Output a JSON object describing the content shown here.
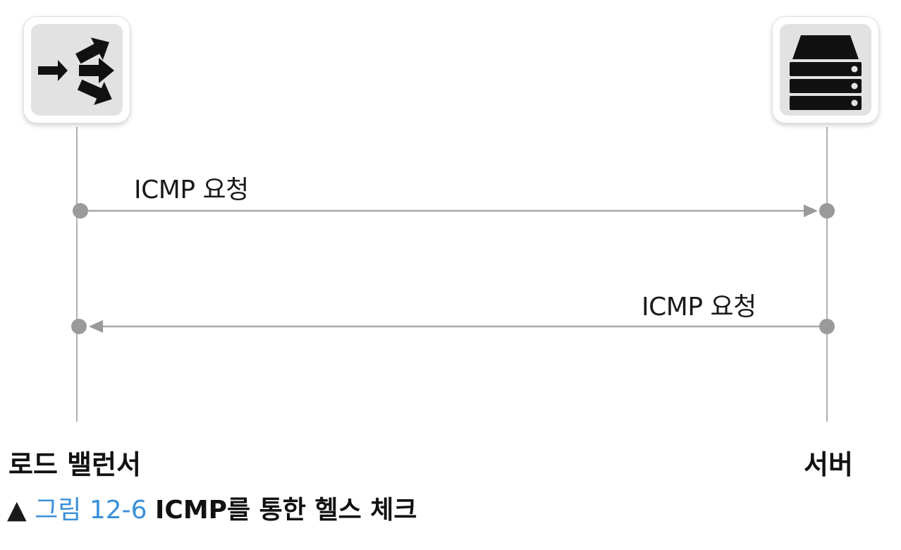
{
  "nodes": {
    "load_balancer": {
      "label": "로드 밸런서",
      "icon": "load-balancer-arrows-icon"
    },
    "server": {
      "label": "서버",
      "icon": "server-rack-icon"
    }
  },
  "messages": [
    {
      "label": "ICMP 요청",
      "from": "load_balancer",
      "to": "server"
    },
    {
      "label": "ICMP 요청",
      "from": "server",
      "to": "load_balancer"
    }
  ],
  "caption": {
    "marker": "▲",
    "figure_word": "그림",
    "figure_number": "12-6",
    "title": "ICMP를 통한 헬스 체크"
  },
  "colors": {
    "line": "#a8a8a8",
    "endpoint": "#9a9a9a",
    "caption_number": "#3a8fd9",
    "icon_tile": "#e2e2e2"
  }
}
